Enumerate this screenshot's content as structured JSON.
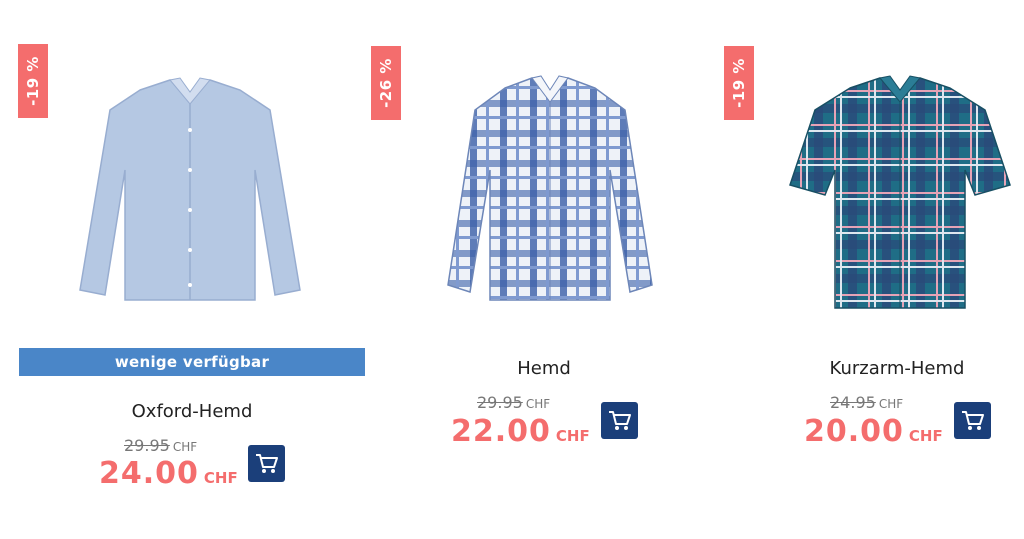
{
  "products": [
    {
      "discount": "-19 %",
      "availability": "wenige verfügbar",
      "name": "Oxford-Hemd",
      "old_price": "29.95",
      "new_price": "24.00",
      "currency": "CHF",
      "shirt_color": "#b5c8e3",
      "shirt_icon": "long-sleeve-shirt-light-blue"
    },
    {
      "discount": "-26 %",
      "name": "Hemd",
      "old_price": "29.95",
      "new_price": "22.00",
      "currency": "CHF",
      "shirt_color": "#e9eef6",
      "shirt_icon": "long-sleeve-shirt-blue-check"
    },
    {
      "discount": "-19 %",
      "name": "Kurzarm-Hemd",
      "old_price": "24.95",
      "new_price": "20.00",
      "currency": "CHF",
      "shirt_color": "#1f6d86",
      "shirt_icon": "short-sleeve-shirt-teal-check"
    }
  ],
  "colors": {
    "sale": "#f46d6d",
    "cart": "#1b3f7a",
    "availability": "#4a86c8"
  },
  "cart_icon": "shopping-cart-icon"
}
